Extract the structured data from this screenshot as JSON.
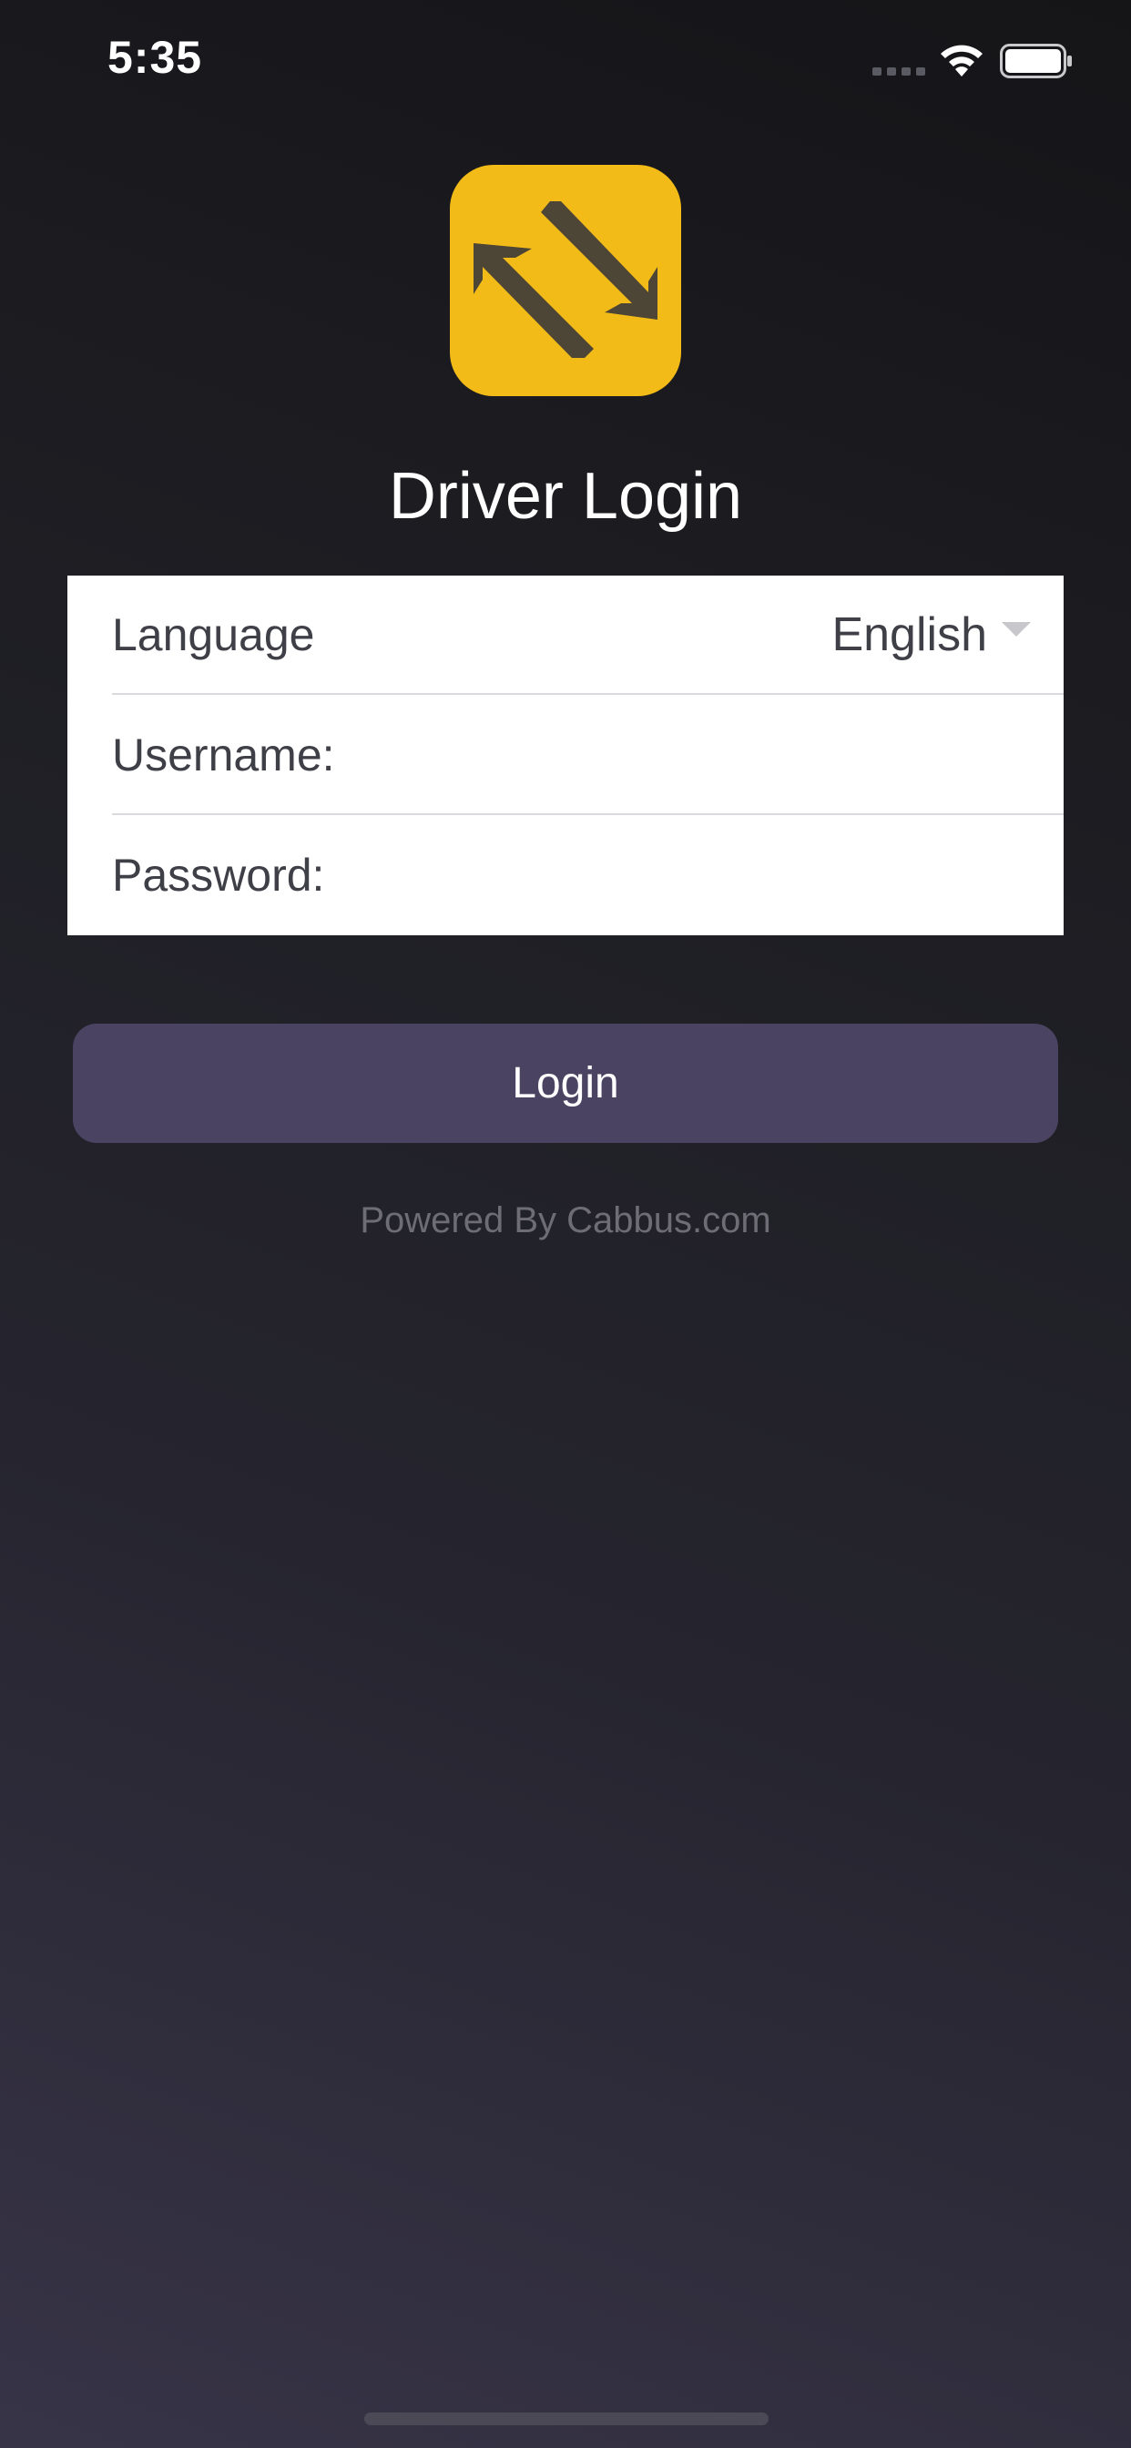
{
  "status_bar": {
    "time": "5:35",
    "signal_icon": "cellular-signal-icon",
    "wifi_icon": "wifi-icon",
    "battery_icon": "battery-icon"
  },
  "logo": {
    "icon": "swap-arrows-logo",
    "background_color": "#f2bb17",
    "glyph_color": "#4d4536"
  },
  "page": {
    "title": "Driver Login"
  },
  "form": {
    "language_label": "Language",
    "language_value": "English",
    "username_label": "Username:",
    "username_value": "",
    "password_label": "Password:",
    "password_value": ""
  },
  "login_button": {
    "label": "Login",
    "color": "#4a4462"
  },
  "footer": {
    "powered_by": "Powered By Cabbus.com"
  }
}
